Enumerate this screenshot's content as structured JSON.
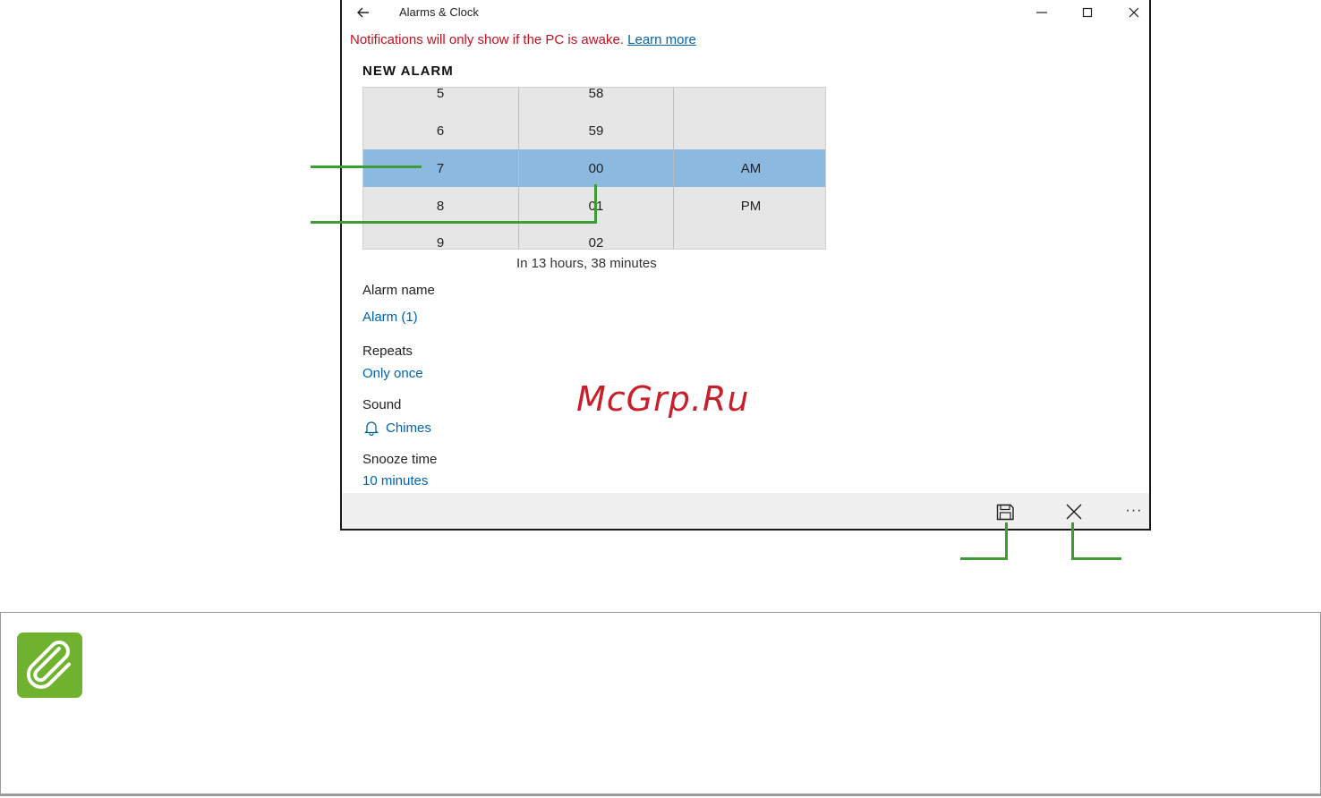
{
  "window": {
    "title": "Alarms & Clock",
    "icons": {
      "back": "back-arrow-icon",
      "minimize": "minimize-icon",
      "maximize": "maximize-icon",
      "close": "close-icon"
    }
  },
  "notice": {
    "text": "Notifications will only show if the PC is awake.",
    "link": "Learn more",
    "color": "#c50f1f"
  },
  "alarm": {
    "heading": "NEW ALARM",
    "hours": [
      "5",
      "6",
      "7",
      "8",
      "9"
    ],
    "minutes": [
      "58",
      "59",
      "00",
      "01",
      "02"
    ],
    "periods": [
      "AM",
      "PM"
    ],
    "selected": {
      "hour": "7",
      "minute": "00",
      "period": "AM"
    },
    "until": "In 13 hours, 38 minutes"
  },
  "fields": {
    "name_label": "Alarm name",
    "name_value": "Alarm (1)",
    "repeats_label": "Repeats",
    "repeats_value": "Only once",
    "sound_label": "Sound",
    "sound_value": "Chimes",
    "sound_icon": "bell-icon",
    "snooze_label": "Snooze time",
    "snooze_value": "10 minutes"
  },
  "commandbar": {
    "save_icon": "save-icon",
    "discard_icon": "close-icon",
    "more_icon": "more-icon",
    "more_glyph": "···"
  },
  "watermark": "McGrp.Ru",
  "colors": {
    "accent": "#0063b1",
    "selection": "#8cb9e0",
    "callout": "#3f9b35",
    "note_icon": "#6fb22d"
  },
  "note": {
    "icon": "paperclip-icon"
  }
}
